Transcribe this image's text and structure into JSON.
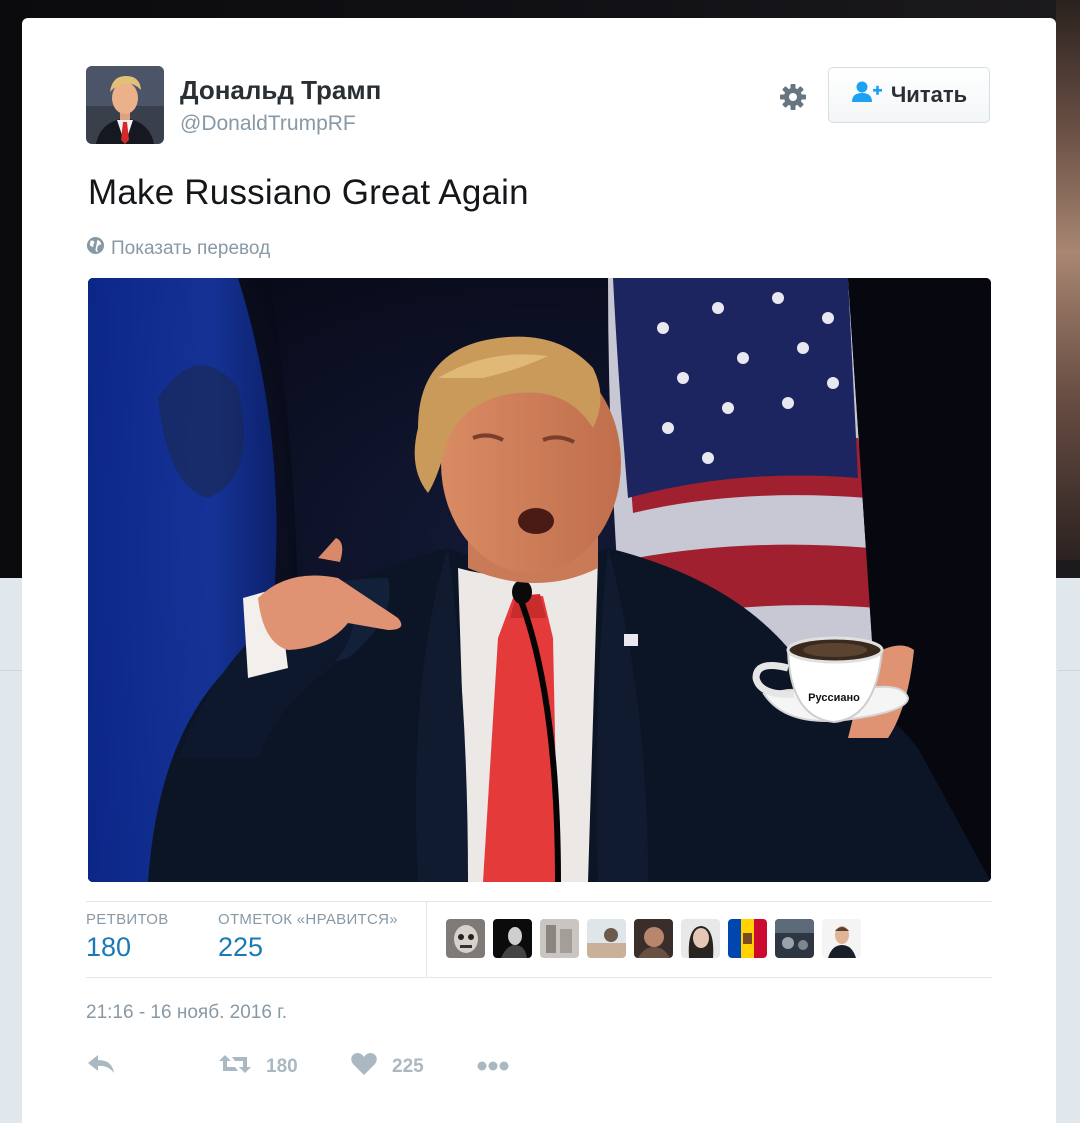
{
  "tweet": {
    "author": {
      "name": "Дональд Трамп",
      "handle": "@DonaldTrumpRF"
    },
    "follow_label": "Читать",
    "text": "Make Russiano Great Again",
    "translate_label": "Показать перевод",
    "photo": {
      "cup_label": "Руссиано"
    },
    "stats": {
      "retweets_label": "РЕТВИТОВ",
      "retweets_value": "180",
      "likes_label": "ОТМЕТОК «НРАВИТСЯ»",
      "likes_value": "225"
    },
    "favoriter_count": 9,
    "timestamp": "21:16 - 16 нояб. 2016 г.",
    "actions": {
      "retweet_count": "180",
      "like_count": "225"
    }
  },
  "colors": {
    "link_blue": "#1b7ab5",
    "muted_gray": "#8899a6",
    "icon_gray": "#aab8c2",
    "follow_icon_blue": "#1da1f2",
    "tie_red": "#e53a3a"
  },
  "icons": [
    "gear-icon",
    "follow-user-icon",
    "globe-icon",
    "reply-icon",
    "retweet-icon",
    "heart-icon",
    "more-icon"
  ]
}
